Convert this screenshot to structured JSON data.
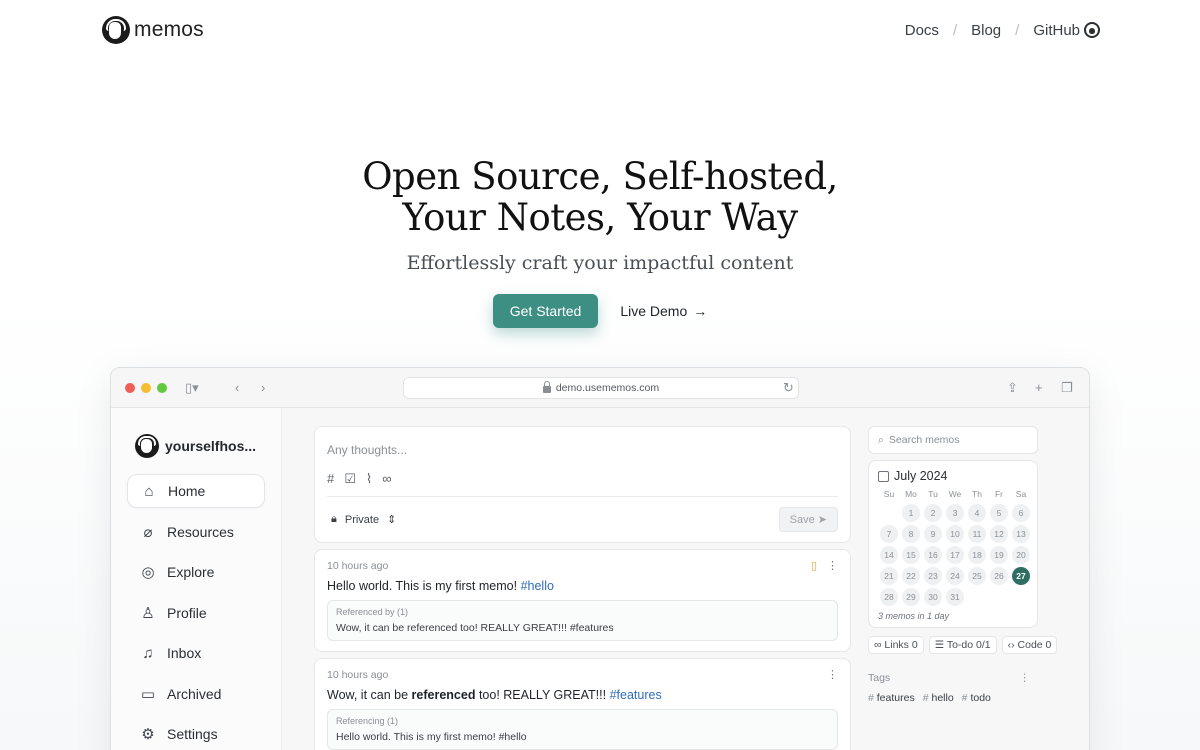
{
  "nav": {
    "brand": "memos",
    "links": [
      "Docs",
      "Blog",
      "GitHub"
    ],
    "separator": "/"
  },
  "hero": {
    "line1": "Open Source, Self-hosted,",
    "line2": "Your Notes, Your Way",
    "subtitle": "Effortlessly craft your impactful content",
    "primary_cta": "Get Started",
    "secondary_cta": "Live Demo",
    "arrow": "→"
  },
  "colors": {
    "primary": "#3e8f83",
    "tag": "#2f6cc0",
    "selected_day": "#2f6f63",
    "bookmark": "#e0a12f"
  },
  "browser": {
    "address": "demo.usememos.com",
    "dots": [
      "#ee5f57",
      "#f6bd2e",
      "#5fc940"
    ]
  },
  "sidebar": {
    "user": "yourselfhos...",
    "items": [
      {
        "label": "Home",
        "icon": "home-icon",
        "glyph": "⌂"
      },
      {
        "label": "Resources",
        "icon": "paperclip-icon",
        "glyph": "⌀"
      },
      {
        "label": "Explore",
        "icon": "globe-icon",
        "glyph": "◎"
      },
      {
        "label": "Profile",
        "icon": "user-icon",
        "glyph": "♙"
      },
      {
        "label": "Inbox",
        "icon": "bell-icon",
        "glyph": "♫"
      },
      {
        "label": "Archived",
        "icon": "archive-icon",
        "glyph": "▭"
      },
      {
        "label": "Settings",
        "icon": "gear-icon",
        "glyph": "⚙"
      }
    ]
  },
  "editor": {
    "placeholder": "Any thoughts...",
    "tools": [
      "#",
      "☑",
      "⌇",
      "∞"
    ],
    "visibility": "Private",
    "visibility_caret": "⇕",
    "save": "Save"
  },
  "memos": [
    {
      "time": "10 hours ago",
      "text_plain": "Hello world. This is my first memo! ",
      "tag": "#hello",
      "ref_header": "Referenced by (1)",
      "ref_body": "Wow, it can be referenced too! REALLY GREAT!!! #features"
    },
    {
      "time": "10 hours ago",
      "text_before": "Wow, it can be ",
      "text_bold": "referenced",
      "text_after": " too! REALLY GREAT!!! ",
      "tag": "#features",
      "ref_header": "Referencing (1)",
      "ref_body": "Hello world. This is my first memo! #hello"
    }
  ],
  "right": {
    "search_placeholder": "Search memos",
    "month": "July 2024",
    "weekdays": [
      "Su",
      "Mo",
      "Tu",
      "We",
      "Th",
      "Fr",
      "Sa"
    ],
    "first_weekday_index": 1,
    "days_in_month": 31,
    "selected_day": 27,
    "note": "3 memos in 1 day",
    "stats": [
      "Links 0",
      "To-do 0/1",
      "Code 0"
    ],
    "tags_title": "Tags",
    "tags": [
      "features",
      "hello",
      "todo"
    ]
  }
}
